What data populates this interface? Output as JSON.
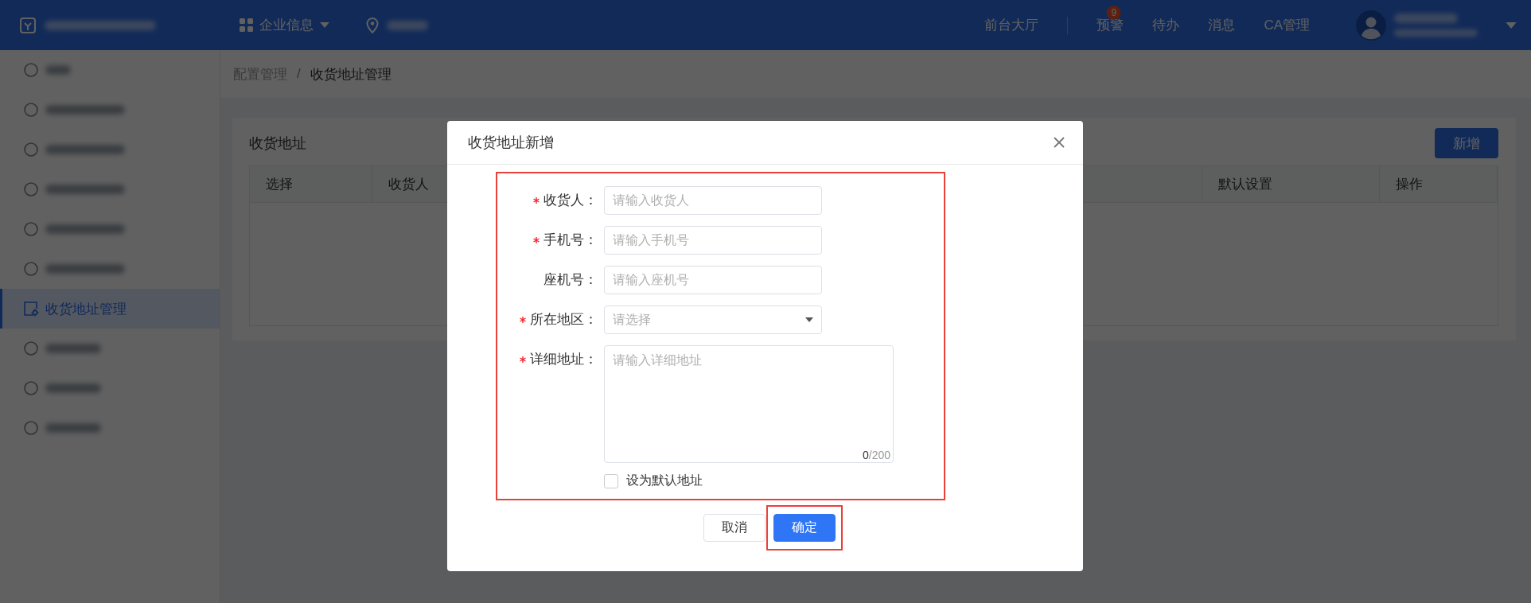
{
  "topbar": {
    "menu": [
      {
        "label": "企业信息",
        "kind": "dropdown"
      }
    ],
    "nav": [
      {
        "label": "前台大厅"
      },
      {
        "label": "预警",
        "badge": "9"
      },
      {
        "label": "待办"
      },
      {
        "label": "消息"
      },
      {
        "label": "CA管理"
      }
    ]
  },
  "sidebar": {
    "items": [
      {
        "selected": false
      },
      {
        "selected": false
      },
      {
        "selected": false
      },
      {
        "selected": false
      },
      {
        "selected": false
      },
      {
        "selected": false
      },
      {
        "label": "收货地址管理",
        "selected": true
      },
      {
        "selected": false
      },
      {
        "selected": false
      },
      {
        "selected": false
      }
    ]
  },
  "breadcrumb": {
    "items": [
      "配置管理",
      "收货地址管理"
    ],
    "separator": "/"
  },
  "card": {
    "title": "收货地址",
    "add_button": "新增",
    "table": {
      "columns": [
        "选择",
        "收货人",
        "默认设置",
        "操作"
      ]
    }
  },
  "dialog": {
    "title": "收货地址新增",
    "form_highlighted": true,
    "fields": [
      {
        "label": "收货人：",
        "required": true,
        "kind": "input",
        "placeholder": "请输入收货人"
      },
      {
        "label": "手机号：",
        "required": true,
        "kind": "input",
        "placeholder": "请输入手机号"
      },
      {
        "label": "座机号：",
        "required": false,
        "kind": "input",
        "placeholder": "请输入座机号"
      },
      {
        "label": "所在地区：",
        "required": true,
        "kind": "select",
        "placeholder": "请选择"
      },
      {
        "label": "详细地址：",
        "required": true,
        "kind": "textarea",
        "placeholder": "请输入详细地址",
        "count": "0",
        "limit": "/200"
      }
    ],
    "checkbox": {
      "label": "设为默认地址",
      "checked": false
    },
    "buttons": [
      {
        "label": "取消",
        "kind": "default",
        "highlighted": false
      },
      {
        "label": "确定",
        "kind": "primary",
        "highlighted": true
      }
    ]
  }
}
